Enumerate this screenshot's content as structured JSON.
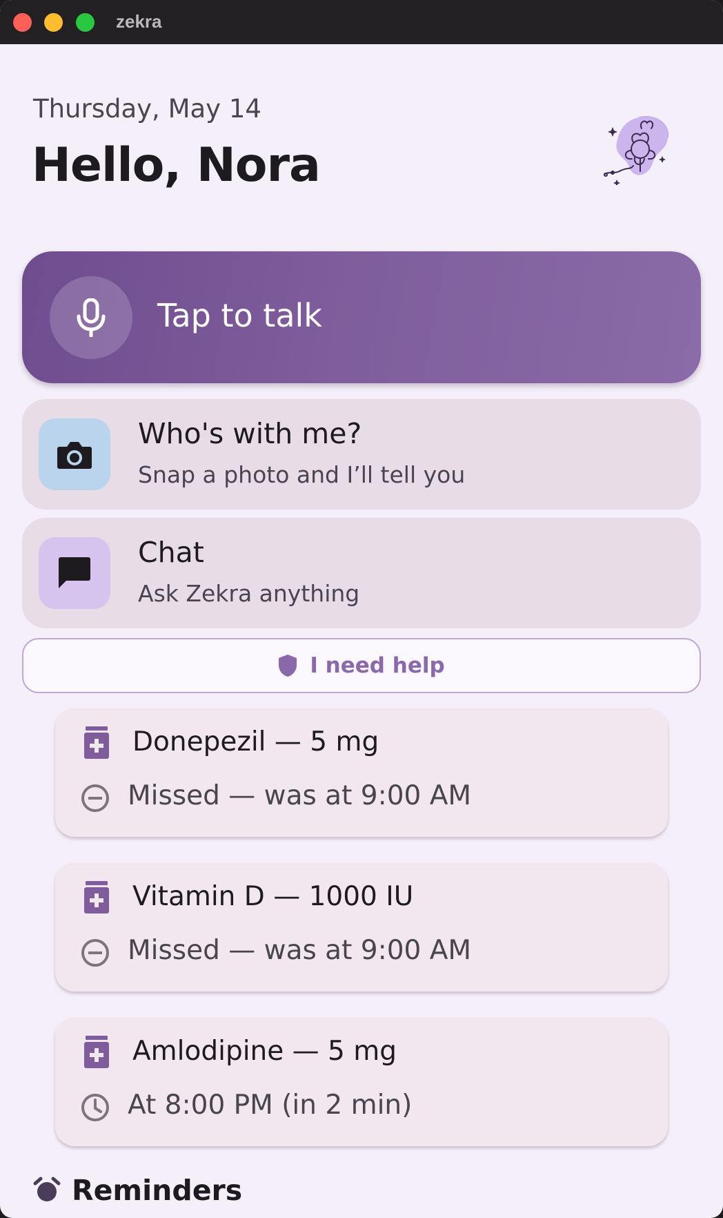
{
  "window": {
    "title": "zekra"
  },
  "header": {
    "date": "Thursday, May 14",
    "greeting": "Hello, Nora"
  },
  "talk": {
    "label": "Tap to talk"
  },
  "actions": [
    {
      "title": "Who's with me?",
      "subtitle": "Snap a photo and I’ll tell you",
      "icon": "camera-icon"
    },
    {
      "title": "Chat",
      "subtitle": "Ask Zekra anything",
      "icon": "chat-icon"
    }
  ],
  "help": {
    "label": "I need help",
    "icon": "shield-icon"
  },
  "medications": [
    {
      "name": "Donepezil — 5 mg",
      "status": "Missed — was at 9:00 AM",
      "status_icon": "missed-icon"
    },
    {
      "name": "Vitamin D — 1000 IU",
      "status": "Missed — was at 9:00 AM",
      "status_icon": "missed-icon"
    },
    {
      "name": "Amlodipine — 5 mg",
      "status": "At 8:00 PM (in 2 min)",
      "status_icon": "clock-icon"
    }
  ],
  "reminders": {
    "label": "Reminders",
    "icon": "alarm-icon"
  },
  "colors": {
    "primary": "#7f5d9c",
    "background": "#f4eff8",
    "card": "#e8dde6",
    "help_accent": "#8a69aa",
    "camera_tile": "#b9d4ec",
    "chat_tile": "#d7c4ee"
  }
}
